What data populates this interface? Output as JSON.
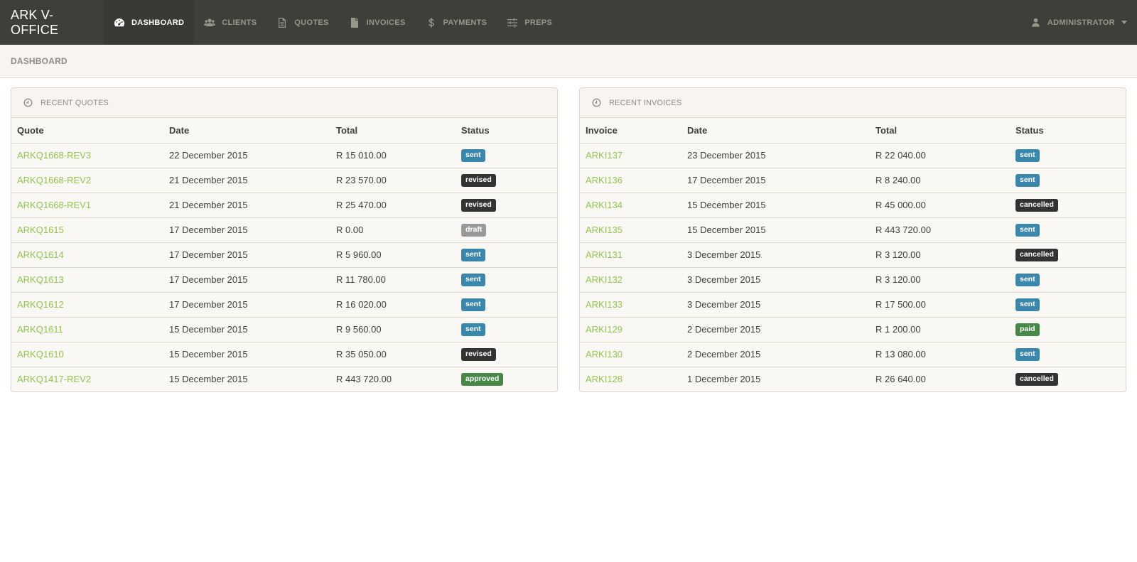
{
  "app": {
    "brand": "ARK V-OFFICE"
  },
  "nav": {
    "items": [
      {
        "label": "DASHBOARD",
        "icon": "dashboard-icon"
      },
      {
        "label": "CLIENTS",
        "icon": "users-icon"
      },
      {
        "label": "QUOTES",
        "icon": "file-icon"
      },
      {
        "label": "INVOICES",
        "icon": "file-text-icon"
      },
      {
        "label": "PAYMENTS",
        "icon": "dollar-icon"
      },
      {
        "label": "PREPS",
        "icon": "sliders-icon"
      }
    ],
    "user": {
      "label": "ADMINISTRATOR",
      "icon": "user-icon"
    }
  },
  "header": {
    "title": "DASHBOARD"
  },
  "quotes_panel": {
    "title": "RECENT QUOTES",
    "columns": [
      "Quote",
      "Date",
      "Total",
      "Status"
    ],
    "rows": [
      {
        "id": "ARKQ1668-REV3",
        "date": "22 December 2015",
        "total": "R 15 010.00",
        "status": "sent"
      },
      {
        "id": "ARKQ1668-REV2",
        "date": "21 December 2015",
        "total": "R 23 570.00",
        "status": "revised"
      },
      {
        "id": "ARKQ1668-REV1",
        "date": "21 December 2015",
        "total": "R 25 470.00",
        "status": "revised"
      },
      {
        "id": "ARKQ1615",
        "date": "17 December 2015",
        "total": "R 0.00",
        "status": "draft"
      },
      {
        "id": "ARKQ1614",
        "date": "17 December 2015",
        "total": "R 5 960.00",
        "status": "sent"
      },
      {
        "id": "ARKQ1613",
        "date": "17 December 2015",
        "total": "R 11 780.00",
        "status": "sent"
      },
      {
        "id": "ARKQ1612",
        "date": "17 December 2015",
        "total": "R 16 020.00",
        "status": "sent"
      },
      {
        "id": "ARKQ1611",
        "date": "15 December 2015",
        "total": "R 9 560.00",
        "status": "sent"
      },
      {
        "id": "ARKQ1610",
        "date": "15 December 2015",
        "total": "R 35 050.00",
        "status": "revised"
      },
      {
        "id": "ARKQ1417-REV2",
        "date": "15 December 2015",
        "total": "R 443 720.00",
        "status": "approved"
      }
    ]
  },
  "invoices_panel": {
    "title": "RECENT INVOICES",
    "columns": [
      "Invoice",
      "Date",
      "Total",
      "Status"
    ],
    "rows": [
      {
        "id": "ARKI137",
        "date": "23 December 2015",
        "total": "R 22 040.00",
        "status": "sent"
      },
      {
        "id": "ARKI136",
        "date": "17 December 2015",
        "total": "R 8 240.00",
        "status": "sent"
      },
      {
        "id": "ARKI134",
        "date": "15 December 2015",
        "total": "R 45 000.00",
        "status": "cancelled"
      },
      {
        "id": "ARKI135",
        "date": "15 December 2015",
        "total": "R 443 720.00",
        "status": "sent"
      },
      {
        "id": "ARKI131",
        "date": "3 December 2015",
        "total": "R 3 120.00",
        "status": "cancelled"
      },
      {
        "id": "ARKI132",
        "date": "3 December 2015",
        "total": "R 3 120.00",
        "status": "sent"
      },
      {
        "id": "ARKI133",
        "date": "3 December 2015",
        "total": "R 17 500.00",
        "status": "sent"
      },
      {
        "id": "ARKI129",
        "date": "2 December 2015",
        "total": "R 1 200.00",
        "status": "paid"
      },
      {
        "id": "ARKI130",
        "date": "2 December 2015",
        "total": "R 13 080.00",
        "status": "sent"
      },
      {
        "id": "ARKI128",
        "date": "1 December 2015",
        "total": "R 26 640.00",
        "status": "cancelled"
      }
    ]
  },
  "colors": {
    "navbar": "#3e3f3a",
    "link": "#93c54b",
    "sent": "#3a87ad",
    "revised": "#333333",
    "draft": "#999999",
    "approved": "#468847",
    "paid": "#468847",
    "cancelled": "#333333"
  }
}
